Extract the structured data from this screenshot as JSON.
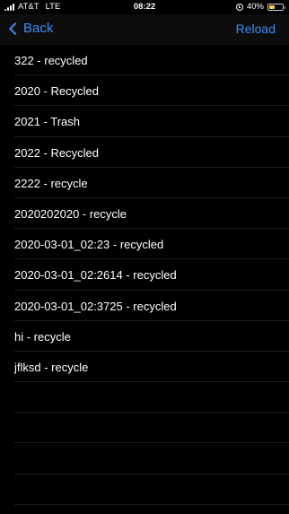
{
  "status_bar": {
    "carrier": "AT&T",
    "network": "LTE",
    "time": "08:22",
    "battery_percent_text": "40%",
    "battery_level": 0.4,
    "battery_color": "#f7ce46"
  },
  "nav": {
    "back_label": "Back",
    "reload_label": "Reload",
    "accent_color": "#3a8df5"
  },
  "items": [
    {
      "label": "322 - recycled"
    },
    {
      "label": "2020 - Recycled"
    },
    {
      "label": "2021 - Trash"
    },
    {
      "label": "2022 - Recycled"
    },
    {
      "label": "2222 - recycle"
    },
    {
      "label": "2020202020 - recycle"
    },
    {
      "label": "2020-03-01_02:23 - recycled"
    },
    {
      "label": "2020-03-01_02:2614 - recycled"
    },
    {
      "label": "2020-03-01_02:3725 - recycled"
    },
    {
      "label": "hi - recycle"
    },
    {
      "label": "jflksd - recycle"
    },
    {
      "label": ""
    },
    {
      "label": ""
    },
    {
      "label": ""
    },
    {
      "label": ""
    }
  ]
}
